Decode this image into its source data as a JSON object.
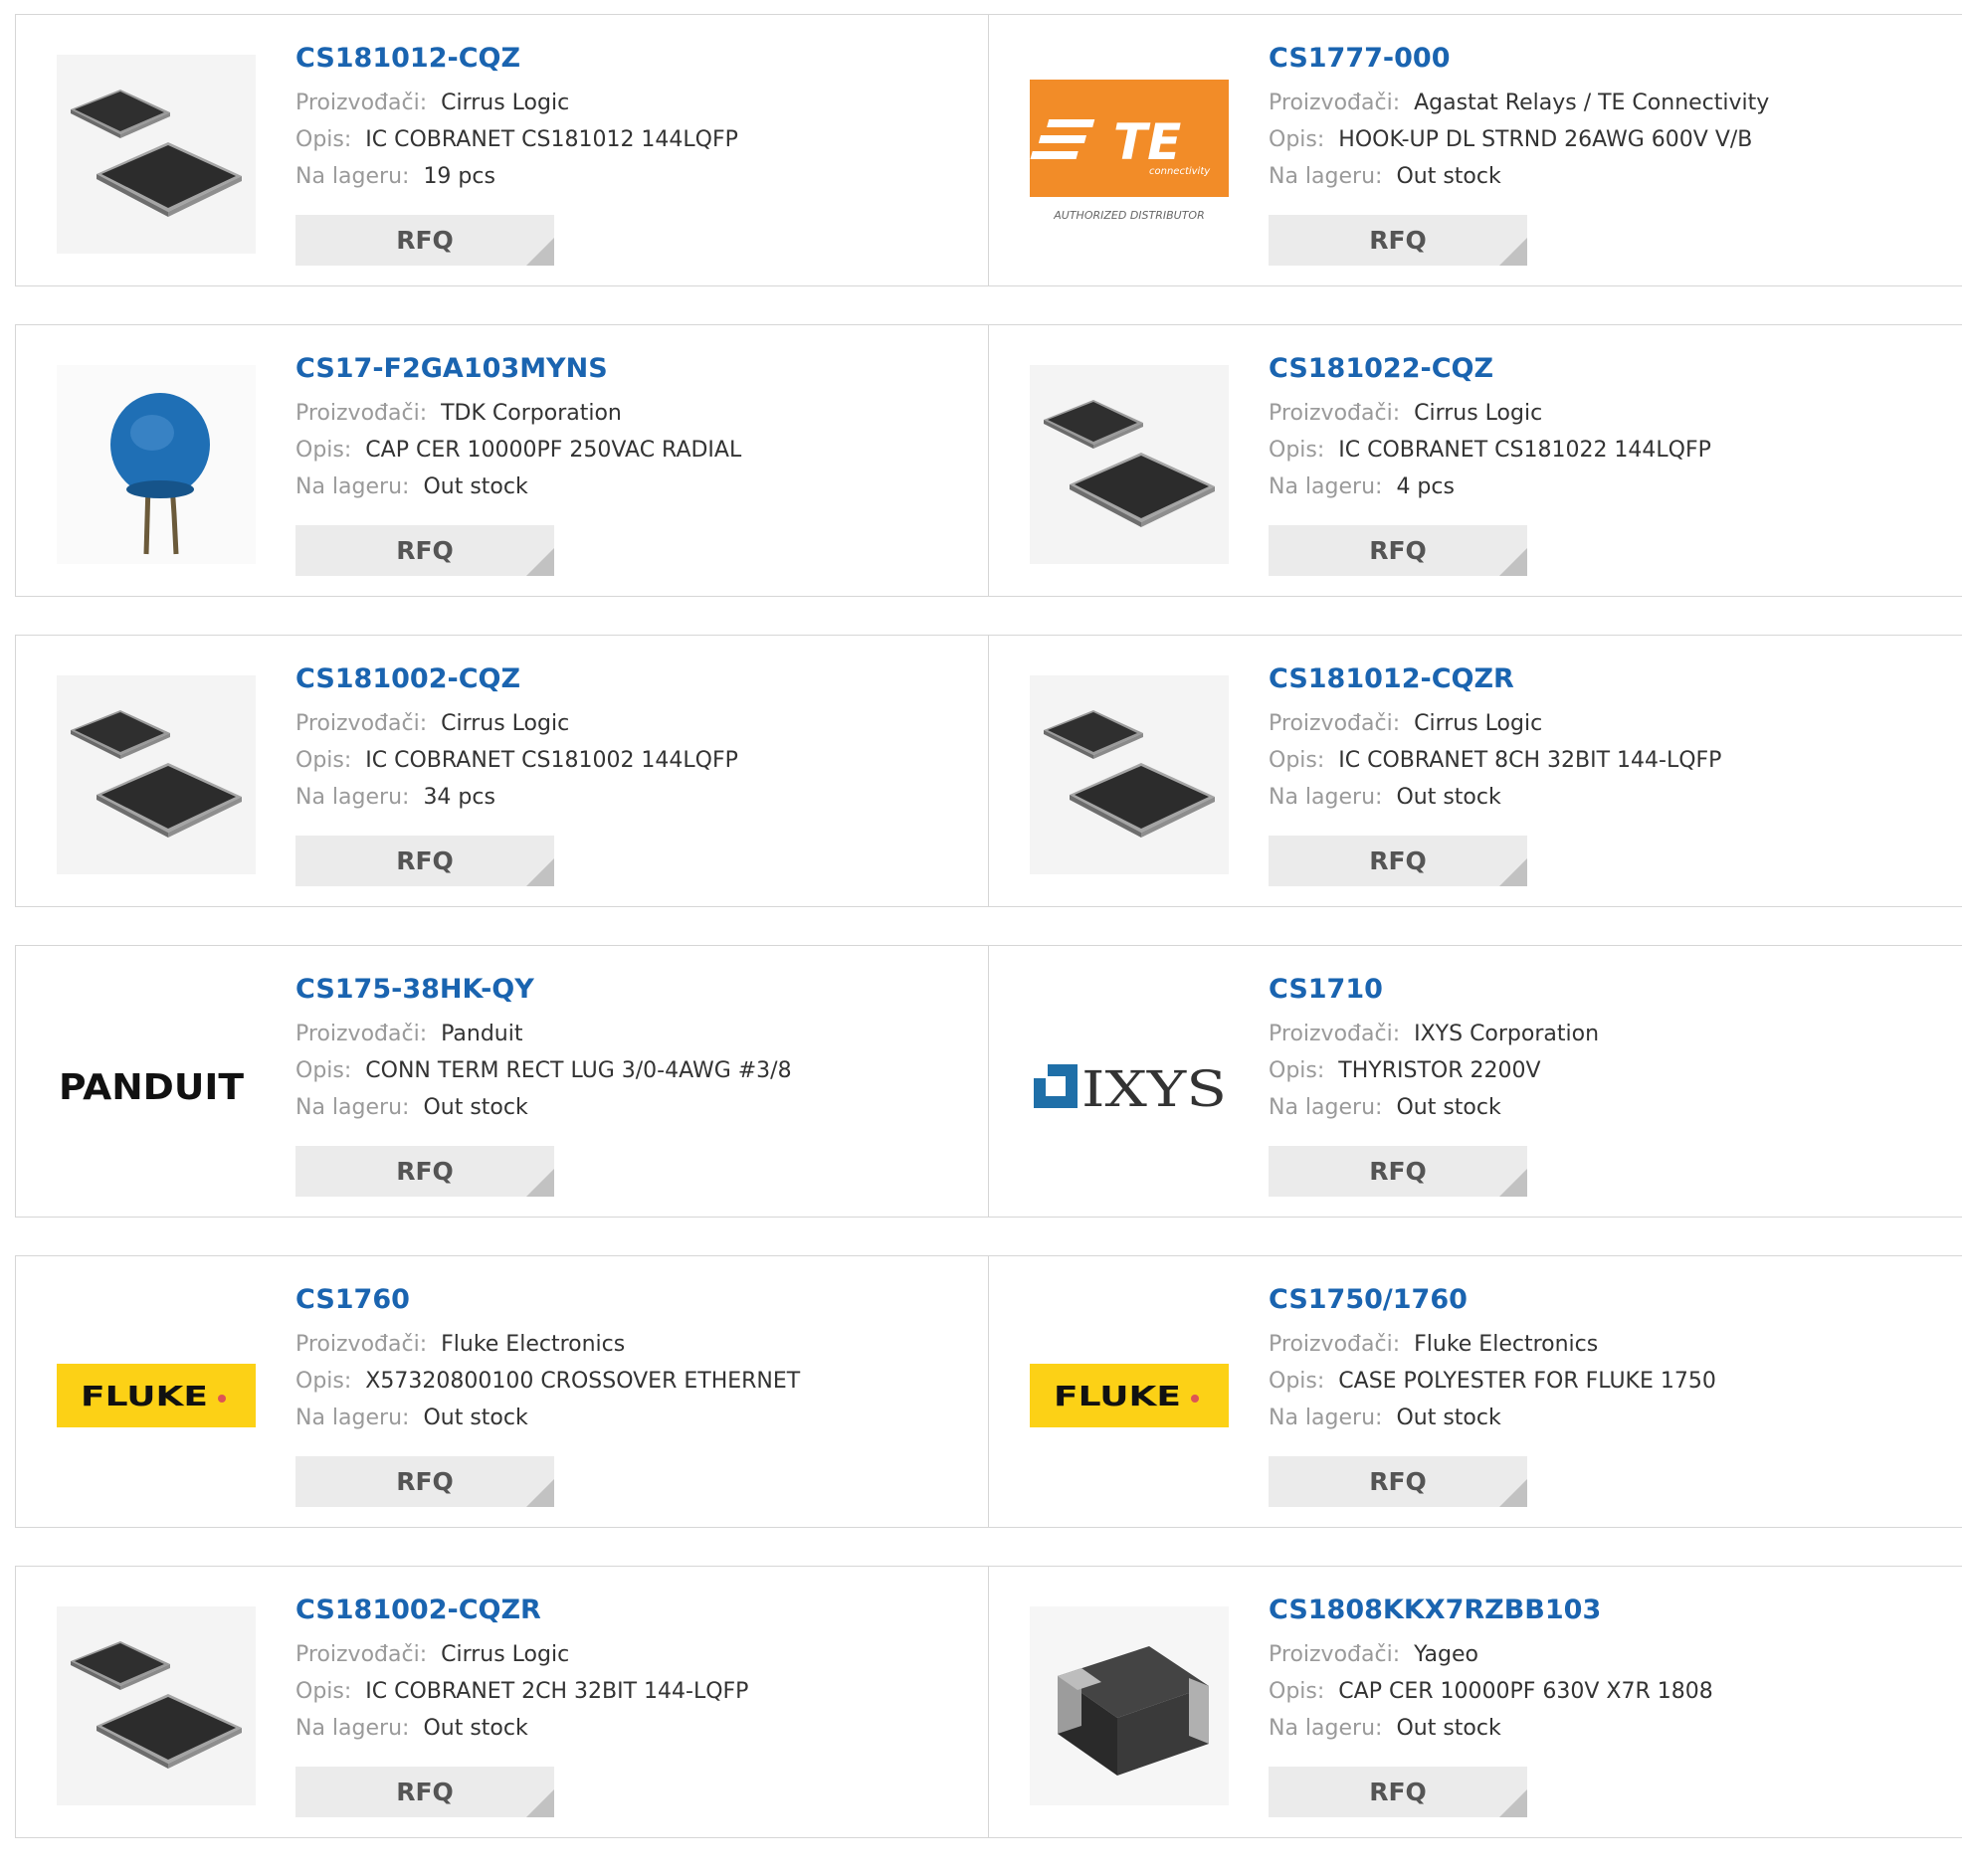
{
  "labels": {
    "manufacturer": "Proizvođači:",
    "description": "Opis:",
    "stock": "Na lageru:",
    "rfq": "RFQ"
  },
  "colors": {
    "part_link": "#1a64b0",
    "label_gray": "#9a9a9a",
    "rfq_bg": "#ebebeb",
    "border": "#d6d6d6",
    "te_orange": "#f28c28",
    "fluke_yellow": "#fcd116",
    "capacitor_blue": "#1f6fb5"
  },
  "products": [
    {
      "part": "CS181012-CQZ",
      "manufacturer": "Cirrus Logic",
      "description": "IC COBRANET CS181012 144LQFP",
      "stock": "19 pcs",
      "image": "qfp-chip-icon"
    },
    {
      "part": "CS1777-000",
      "manufacturer": "Agastat Relays / TE Connectivity",
      "description": "HOOK-UP DL STRND 26AWG 600V V/B",
      "stock": "Out stock",
      "image": "te-logo"
    },
    {
      "part": "CS17-F2GA103MYNS",
      "manufacturer": "TDK Corporation",
      "description": "CAP CER 10000PF 250VAC RADIAL",
      "stock": "Out stock",
      "image": "disc-capacitor-icon"
    },
    {
      "part": "CS181022-CQZ",
      "manufacturer": "Cirrus Logic",
      "description": "IC COBRANET CS181022 144LQFP",
      "stock": "4 pcs",
      "image": "qfp-chip-icon"
    },
    {
      "part": "CS181002-CQZ",
      "manufacturer": "Cirrus Logic",
      "description": "IC COBRANET CS181002 144LQFP",
      "stock": "34 pcs",
      "image": "qfp-chip-icon"
    },
    {
      "part": "CS181012-CQZR",
      "manufacturer": "Cirrus Logic",
      "description": "IC COBRANET 8CH 32BIT 144-LQFP",
      "stock": "Out stock",
      "image": "qfp-chip-icon"
    },
    {
      "part": "CS175-38HK-QY",
      "manufacturer": "Panduit",
      "description": "CONN TERM RECT LUG 3/0-4AWG #3/8",
      "stock": "Out stock",
      "image": "panduit-logo"
    },
    {
      "part": "CS1710",
      "manufacturer": "IXYS Corporation",
      "description": "THYRISTOR 2200V",
      "stock": "Out stock",
      "image": "ixys-logo"
    },
    {
      "part": "CS1760",
      "manufacturer": "Fluke Electronics",
      "description": "X57320800100 CROSSOVER ETHERNET",
      "stock": "Out stock",
      "image": "fluke-logo"
    },
    {
      "part": "CS1750/1760",
      "manufacturer": "Fluke Electronics",
      "description": "CASE POLYESTER FOR FLUKE 1750",
      "stock": "Out stock",
      "image": "fluke-logo"
    },
    {
      "part": "CS181002-CQZR",
      "manufacturer": "Cirrus Logic",
      "description": "IC COBRANET 2CH 32BIT 144-LQFP",
      "stock": "Out stock",
      "image": "qfp-chip-icon"
    },
    {
      "part": "CS1808KKX7RZBB103",
      "manufacturer": "Yageo",
      "description": "CAP CER 10000PF 630V X7R 1808",
      "stock": "Out stock",
      "image": "smd-capacitor-icon"
    }
  ],
  "logos": {
    "te": {
      "mark": "TE",
      "sub": "connectivity",
      "tagline": "AUTHORIZED DISTRIBUTOR"
    },
    "panduit": {
      "text": "PANDUIT"
    },
    "ixys": {
      "text": "IXYS"
    },
    "fluke": {
      "text": "FLUKE"
    }
  }
}
